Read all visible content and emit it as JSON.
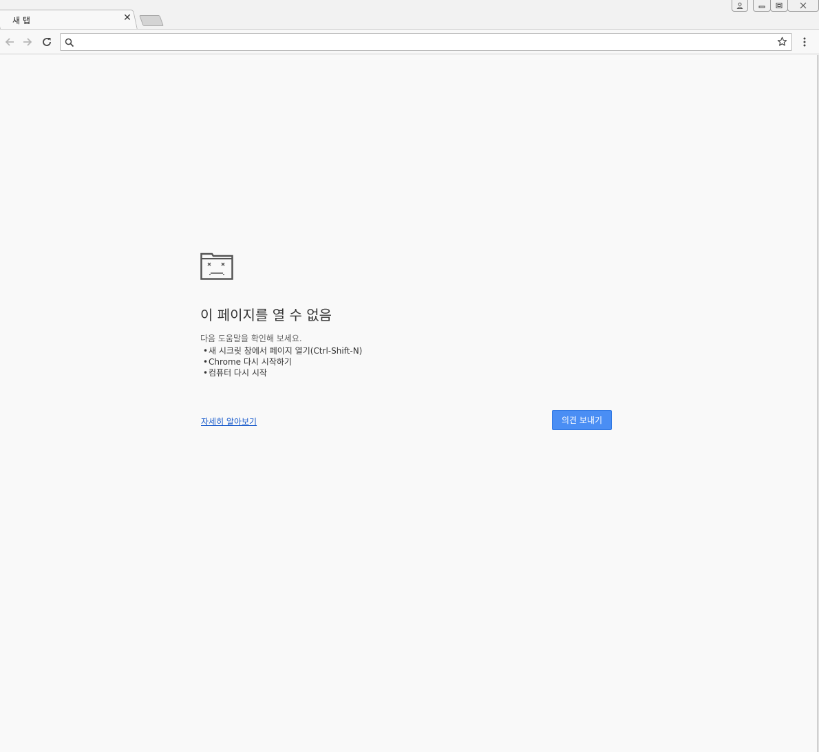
{
  "tab": {
    "title": "새 탭"
  },
  "omnibox": {
    "value": "",
    "placeholder": ""
  },
  "error": {
    "title": "이 페이지를 열 수 없음",
    "subtitle": "다음 도움말을 확인해 보세요.",
    "suggestions": [
      "새 시크릿 창에서 페이지 열기(Ctrl-Shift-N)",
      "Chrome 다시 시작하기",
      "컴퓨터 다시 시작"
    ],
    "learn_more": "자세히 알아보기",
    "feedback_button": "의견 보내기",
    "bullet": "•"
  },
  "colors": {
    "accent": "#4a8ef4",
    "link": "#1a5ccc",
    "background": "#f9f9f9"
  },
  "icons": [
    "search-icon",
    "star-icon",
    "menu-icon",
    "back-icon",
    "forward-icon",
    "reload-icon",
    "sad-tab-icon",
    "close-icon",
    "profile-icon",
    "minimize-icon",
    "restore-icon"
  ]
}
